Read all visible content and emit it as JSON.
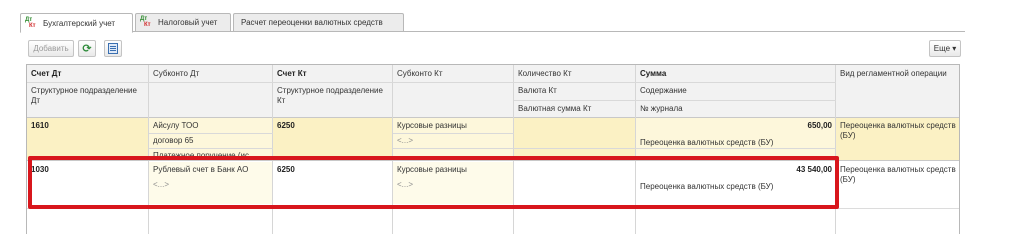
{
  "tabs": [
    {
      "label": "Бухгалтерский учет",
      "icon_top": "Дт",
      "icon_bottom": "Кт"
    },
    {
      "label": "Налоговый учет",
      "icon_top": "Дт",
      "icon_bottom": "Кт"
    },
    {
      "label": "Расчет переоценки валютных средств"
    }
  ],
  "toolbar": {
    "add_label": "Добавить",
    "refresh_icon": "refresh-icon",
    "report_icon": "document-icon",
    "more_label": "Еще ▾"
  },
  "columns": {
    "schet_dt": "Счет Дт",
    "subkonto_dt": "Субконто Дт",
    "schet_kt": "Счет Кт",
    "subkonto_kt": "Субконто Кт",
    "kolichestvo_kt": "Количество Кт",
    "summa": "Сумма",
    "vid_operacii": "Вид регламентной операции",
    "podrazdelenie_dt": "Структурное подразделение Дт",
    "podrazdelenie_kt": "Структурное подразделение Кт",
    "valyuta_kt": "Валюта Кт",
    "valyutnaya_summa_kt": "Валютная сумма Кт",
    "soderzhanie": "Содержание",
    "nomer_zhurnala": "№ журнала"
  },
  "rows": [
    {
      "schet_dt": "1610",
      "subkonto_dt": [
        "Айсулу ТОО",
        "договор 65",
        "Платежное поручение (ис"
      ],
      "schet_kt": "6250",
      "subkonto_kt": [
        "Курсовые разницы",
        "<...>"
      ],
      "summa": "650,00",
      "soderzhanie": "Переоценка валютных средств (БУ)",
      "vid_operacii": "Переоценка валютных средств (БУ)"
    },
    {
      "schet_dt": "1030",
      "subkonto_dt": [
        "Рублевый счет в Банк АО",
        "<...>"
      ],
      "schet_kt": "6250",
      "subkonto_kt": [
        "Курсовые разницы",
        "<...>"
      ],
      "summa": "43 540,00",
      "soderzhanie": "Переоценка валютных средств (БУ)",
      "vid_operacii": "Переоценка валютных средств (БУ)"
    }
  ],
  "colors": {
    "highlight": "#d8161c",
    "row_selected": "#fbf1c4",
    "tab_icon_top": "#2d8a2d",
    "tab_icon_bottom": "#d12b2b"
  }
}
